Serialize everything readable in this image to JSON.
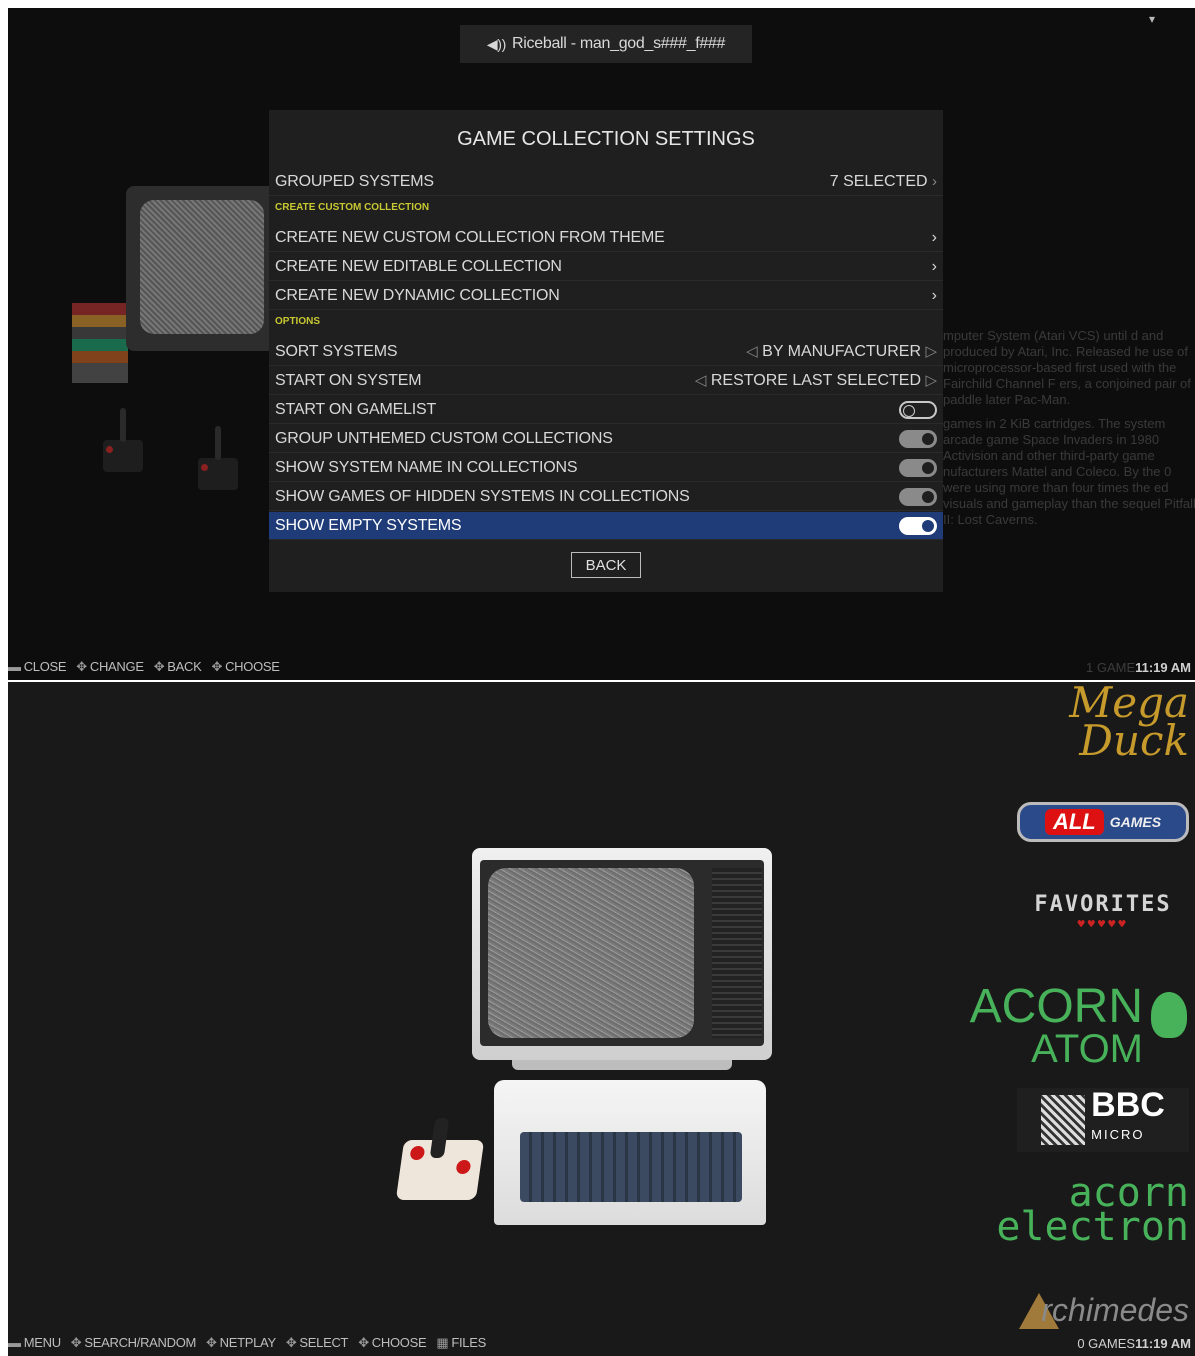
{
  "top": {
    "now_playing": "Riceball - man_god_s###_f###",
    "dialog": {
      "title": "GAME COLLECTION SETTINGS",
      "grouped_systems": {
        "label": "GROUPED SYSTEMS",
        "value": "7 SELECTED"
      },
      "header_custom": "CREATE CUSTOM COLLECTION",
      "create_theme": "CREATE NEW CUSTOM COLLECTION FROM THEME",
      "create_editable": "CREATE NEW EDITABLE COLLECTION",
      "create_dynamic": "CREATE NEW DYNAMIC COLLECTION",
      "header_options": "OPTIONS",
      "sort_systems": {
        "label": "SORT SYSTEMS",
        "value": "BY MANUFACTURER"
      },
      "start_on_system": {
        "label": "START ON SYSTEM",
        "value": "RESTORE LAST SELECTED"
      },
      "start_on_gamelist": {
        "label": "START ON GAMELIST",
        "state": "off"
      },
      "group_unthemed": {
        "label": "GROUP UNTHEMED CUSTOM COLLECTIONS",
        "state": "on"
      },
      "show_system_name": {
        "label": "SHOW SYSTEM NAME IN COLLECTIONS",
        "state": "on"
      },
      "show_hidden_games": {
        "label": "SHOW GAMES OF HIDDEN SYSTEMS IN COLLECTIONS",
        "state": "on"
      },
      "show_empty": {
        "label": "SHOW EMPTY SYSTEMS",
        "state": "on"
      },
      "back": "BACK"
    },
    "background_text": [
      "mputer System (Atari VCS) until d and produced by Atari, Inc. Released he use of microprocessor-based first used with the Fairchild Channel F ers, a conjoined pair of paddle later Pac-Man.",
      "games in 2 KiB cartridges. The system arcade game Space Invaders in 1980 Activision and other third-party game nufacturers Mattel and Coleco. By the 0 were using more than four times the ed visuals and gameplay than the sequel Pitfall II: Lost Caverns."
    ],
    "help": [
      "CLOSE",
      "CHANGE",
      "BACK",
      "CHOOSE"
    ],
    "game_count": "1 GAME",
    "time": "11:19 AM"
  },
  "bottom": {
    "help": [
      "MENU",
      "SEARCH/RANDOM",
      "NETPLAY",
      "SELECT",
      "CHOOSE",
      "FILES"
    ],
    "game_count": "0 GAMES",
    "time": "11:19 AM",
    "logos": {
      "mega_duck_1": "Mega",
      "mega_duck_2": "Duck",
      "all_games_1": "ALL",
      "all_games_2": "GAMES",
      "favorites": "FAVORITES",
      "favorites_hearts": "♥♥♥♥♥",
      "acorn_atom_1": "ACORN",
      "acorn_atom_2": "ATOM",
      "bbc_1": "BBC",
      "bbc_2": "MICRO",
      "acorn_electron_1": "acorn",
      "acorn_electron_2": "electron",
      "archimedes": "rchimedes"
    }
  },
  "colors": {
    "selected_row": "#1f3c78",
    "section_header": "#c8c832",
    "acorn_green": "#47b25a"
  }
}
